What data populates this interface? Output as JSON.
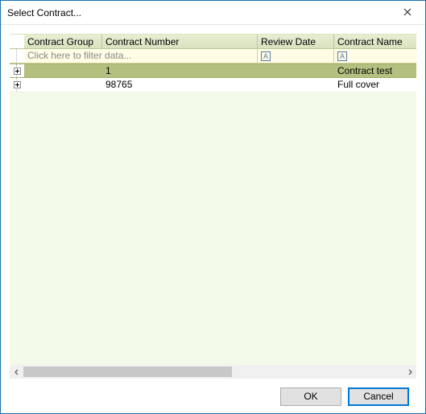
{
  "window": {
    "title": "Select Contract..."
  },
  "grid": {
    "headers": {
      "group": "Contract Group",
      "number": "Contract Number",
      "review": "Review Date",
      "name": "Contract Name"
    },
    "filter_placeholder": "Click here to filter data...",
    "filter_glyph": "A",
    "rows": [
      {
        "group": "",
        "number": "1",
        "review": "",
        "name": "Contract test",
        "selected": true
      },
      {
        "group": "",
        "number": "98765",
        "review": "",
        "name": "Full cover",
        "selected": false
      }
    ]
  },
  "buttons": {
    "ok": "OK",
    "cancel": "Cancel"
  }
}
